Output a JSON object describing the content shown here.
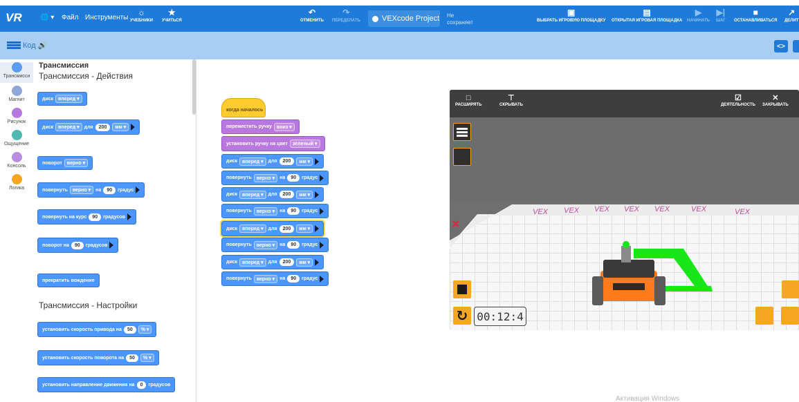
{
  "toolbar": {
    "logo": "VR",
    "file": "Файл",
    "tools": "Инструменты",
    "tutorials": "УЧЕБНИКИ",
    "learn": "УЧИТЬСЯ",
    "undo": "ОТМЕНИТЬ",
    "redo": "ПЕРЕДЕЛАТЬ",
    "project_name": "VEXcode Project",
    "save_status": "Не сохраняет",
    "select_playground": "ВЫБРАТЬ ИГРОВУЮ ПЛОЩАДКУ",
    "open_playground": "ОТКРЫТАЯ ИГРОВАЯ ПЛОЩАДКА",
    "start": "НАЧИНАТЬ",
    "step": "ШАГ",
    "stop": "ОСТАНАВЛИВАТЬСЯ",
    "share": "ДЕЛИТ"
  },
  "subbar": {
    "code_label": "Код"
  },
  "categories": [
    {
      "label": "Трансмисси",
      "color": "#5b9cf0"
    },
    {
      "label": "Магнит",
      "color": "#8fa6d8"
    },
    {
      "label": "Рисунок",
      "color": "#b977e0"
    },
    {
      "label": "Ощущение",
      "color": "#4fb8b0"
    },
    {
      "label": "Консоль",
      "color": "#b98de0"
    },
    {
      "label": "Логика",
      "color": "#f5a623"
    }
  ],
  "flyout": {
    "section_header": "Трансмиссия",
    "actions_title": "Трансмиссия - Действия",
    "settings_title": "Трансмиссия - Настройки",
    "b1": {
      "t1": "диск",
      "d1": "вперед"
    },
    "b2": {
      "t1": "диск",
      "d1": "вперед",
      "t2": "для",
      "n1": "200",
      "d2": "мм"
    },
    "b3": {
      "t1": "поворот",
      "d1": "верно"
    },
    "b4": {
      "t1": "повернуть",
      "d1": "верно",
      "t2": "на",
      "n1": "90",
      "t3": "градус"
    },
    "b5": {
      "t1": "повернуть на курс",
      "n1": "90",
      "t2": "градусов"
    },
    "b6": {
      "t1": "поворот на",
      "n1": "90",
      "t2": "градусов"
    },
    "b7": {
      "t1": "прекратить вождение"
    },
    "b8": {
      "t1": "установить скорость привода на",
      "n1": "50",
      "d1": "%"
    },
    "b9": {
      "t1": "установить скорость поворота на",
      "n1": "50",
      "d1": "%"
    },
    "b10": {
      "t1": "установить направление движения на",
      "n1": "0",
      "t2": "градусов"
    }
  },
  "script": {
    "hat": "когда началось",
    "pen_move": {
      "t1": "переместить ручку",
      "d1": "вниз"
    },
    "pen_color": {
      "t1": "установить ручку на цвет",
      "d1": "зеленый"
    },
    "drive1": {
      "t1": "диск",
      "d1": "вперед",
      "t2": "для",
      "n1": "200",
      "d2": "мм"
    },
    "turn1": {
      "t1": "повернуть",
      "d1": "верно",
      "t2": "на",
      "n1": "90",
      "t3": "градус"
    },
    "drive2": {
      "t1": "диск",
      "d1": "вперед",
      "t2": "для",
      "n1": "200",
      "d2": "мм"
    },
    "turn2": {
      "t1": "повернуть",
      "d1": "верно",
      "t2": "на",
      "n1": "90",
      "t3": "градус"
    },
    "drive3": {
      "t1": "диск",
      "d1": "вперед",
      "t2": "для",
      "n1": "200",
      "d2": "мм"
    },
    "turn3": {
      "t1": "повернуть",
      "d1": "верно",
      "t2": "на",
      "n1": "90",
      "t3": "градус"
    },
    "drive4": {
      "t1": "диск",
      "d1": "вперед",
      "t2": "для",
      "n1": "200",
      "d2": "мм"
    },
    "turn4": {
      "t1": "повернуть",
      "d1": "верно",
      "t2": "на",
      "n1": "90",
      "t3": "градус"
    }
  },
  "playground": {
    "expand": "РАСШИРЯТЬ",
    "hide": "СКРЫВАТЬ",
    "activity": "ДЕЯТЕЛЬНОСТЬ",
    "close": "ЗАКРЫВАТЬ",
    "wall_logo": "VEX",
    "timer": "00:12:4"
  },
  "watermark": "Активация Windows",
  "colors": {
    "accent": "#1f7bd9",
    "subbar": "#a8cff3",
    "block_blue": "#4c97ff",
    "block_purple": "#b977e0",
    "hat_yellow": "#ffcc2f",
    "pen_trail": "#19e619"
  }
}
